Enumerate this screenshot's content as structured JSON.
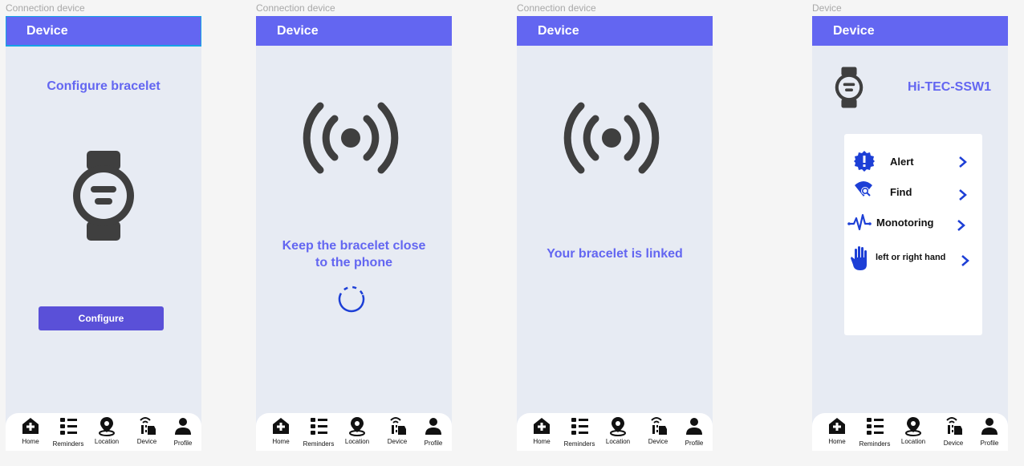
{
  "colors": {
    "accent": "#6366f1",
    "button": "#5a50d8",
    "screen_bg": "#e7ebf3",
    "icon_dark": "#3f3f3f",
    "menu_icon_blue": "#1d3fd6"
  },
  "frames": [
    {
      "label": "Connection device",
      "header": "Device"
    },
    {
      "label": "Connection device",
      "header": "Device"
    },
    {
      "label": "Connection device",
      "header": "Device"
    },
    {
      "label": "Device",
      "header": "Device"
    }
  ],
  "screen1": {
    "title": "Configure bracelet",
    "icon": "watch-icon",
    "button": "Configure"
  },
  "screen2": {
    "line1": "Keep the bracelet close",
    "line2": "to the phone",
    "icon": "signal-icon",
    "spinner": "loading-spinner-icon"
  },
  "screen3": {
    "message": "Your bracelet is linked",
    "icon": "signal-icon"
  },
  "screen4": {
    "device_name": "Hi-TEC-SSW1",
    "menu": [
      {
        "label": "Alert",
        "icon": "alert-badge-icon"
      },
      {
        "label": "Find",
        "icon": "find-signal-icon"
      },
      {
        "label": "Monotoring",
        "icon": "heartbeat-icon"
      },
      {
        "label": "left or right hand",
        "icon": "hand-icon"
      }
    ]
  },
  "nav": [
    {
      "label": "Home",
      "icon": "home-plus-icon"
    },
    {
      "label": "Reminders",
      "icon": "list-icon"
    },
    {
      "label": "Location",
      "icon": "location-pin-icon"
    },
    {
      "label": "Device",
      "icon": "device-tap-icon"
    },
    {
      "label": "Profile",
      "icon": "profile-icon"
    }
  ]
}
